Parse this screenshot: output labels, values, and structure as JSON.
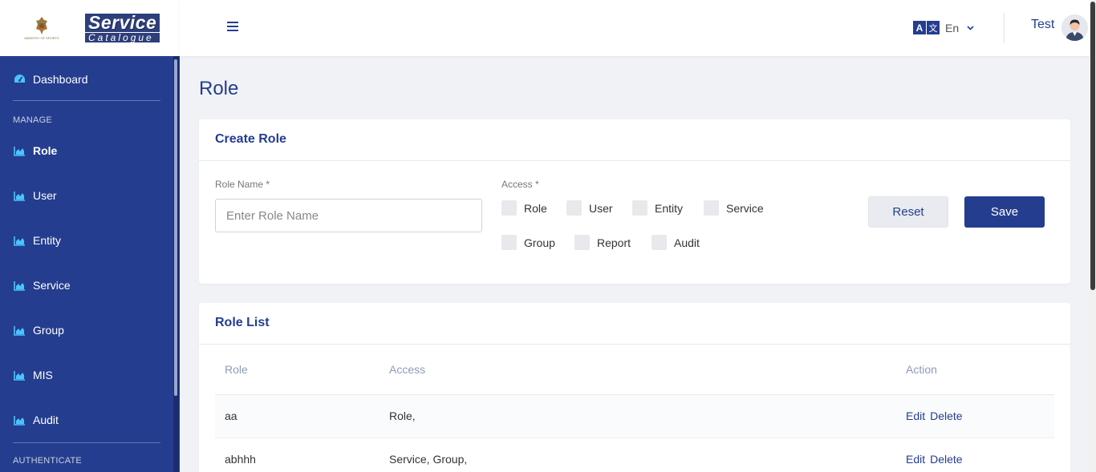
{
  "brand": {
    "emblem_text": "MINISTRY OF SPORTS",
    "title": "Service",
    "subtitle": "Catalogue"
  },
  "sidebar": {
    "dashboard_label": "Dashboard",
    "section_manage": "MANAGE",
    "items": [
      {
        "label": "Role",
        "icon": "chart-icon",
        "active": true
      },
      {
        "label": "User",
        "icon": "chart-icon"
      },
      {
        "label": "Entity",
        "icon": "chart-icon"
      },
      {
        "label": "Service",
        "icon": "chart-icon"
      },
      {
        "label": "Group",
        "icon": "chart-icon"
      },
      {
        "label": "MIS",
        "icon": "chart-icon"
      },
      {
        "label": "Audit",
        "icon": "chart-icon"
      }
    ],
    "section_authenticate": "AUTHENTICATE"
  },
  "topbar": {
    "language": "En",
    "lang_icon_a": "A",
    "lang_icon_b": "文",
    "user_name": "Test"
  },
  "page": {
    "title": "Role"
  },
  "create_role": {
    "header": "Create Role",
    "role_name_label": "Role Name *",
    "role_name_value": "",
    "role_name_placeholder": "Enter Role Name",
    "access_label": "Access *",
    "access_options": [
      "Role",
      "User",
      "Entity",
      "Service",
      "Group",
      "Report",
      "Audit"
    ],
    "reset_label": "Reset",
    "save_label": "Save"
  },
  "role_list": {
    "header": "Role List",
    "columns": [
      "Role",
      "Access",
      "Action"
    ],
    "rows": [
      {
        "role": "aa",
        "access": "Role,",
        "edit": "Edit",
        "delete": "Delete"
      },
      {
        "role": "abhhh",
        "access": "Service, Group,",
        "edit": "Edit",
        "delete": "Delete"
      }
    ]
  },
  "colors": {
    "primary": "#243d8f",
    "background": "#f1f2f6",
    "accent_icon": "#4cc3ff"
  }
}
